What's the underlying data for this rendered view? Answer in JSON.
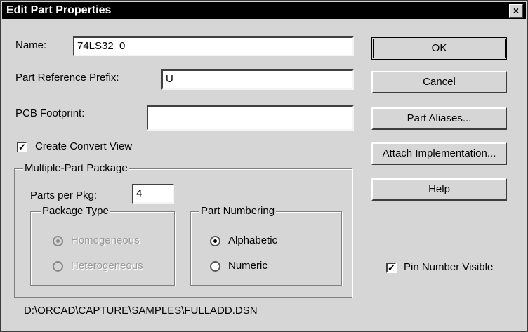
{
  "window": {
    "title": "Edit Part Properties",
    "close_glyph": "×"
  },
  "fields": {
    "name": {
      "label": "Name:",
      "value": "74LS32_0"
    },
    "prefix": {
      "label": "Part Reference Prefix:",
      "value": "U"
    },
    "footprint": {
      "label": "PCB Footprint:",
      "value": ""
    }
  },
  "create_convert_view": {
    "label": "Create Convert View",
    "checked": true,
    "mark": "✓"
  },
  "multi_part": {
    "title": "Multiple-Part Package",
    "parts_per_pkg_label": "Parts per Pkg:",
    "parts_per_pkg_value": "4",
    "package_type": {
      "title": "Package Type",
      "homogeneous": "Homogeneous",
      "heterogeneous": "Heterogeneous",
      "selected": "homogeneous",
      "enabled": false
    },
    "part_numbering": {
      "title": "Part Numbering",
      "alphabetic": "Alphabetic",
      "numeric": "Numeric",
      "selected": "alphabetic"
    }
  },
  "buttons": {
    "ok": "OK",
    "cancel": "Cancel",
    "part_aliases": "Part Aliases...",
    "attach_implementation": "Attach Implementation...",
    "help": "Help"
  },
  "pin_number_visible": {
    "label": "Pin Number Visible",
    "checked": true,
    "mark": "✓"
  },
  "status_path": "D:\\ORCAD\\CAPTURE\\SAMPLES\\FULLADD.DSN"
}
